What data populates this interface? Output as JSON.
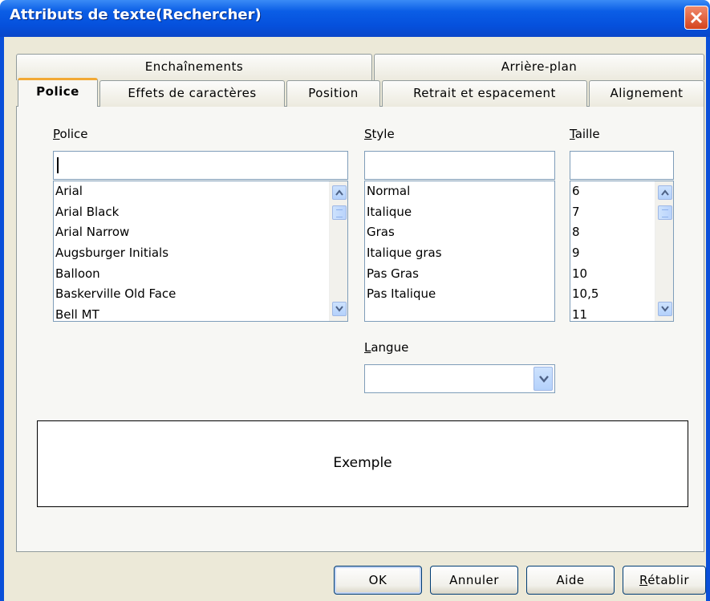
{
  "window": {
    "title": "Attributs de texte(Rechercher)",
    "close_icon": "close-icon",
    "accent_color": "#0a4fd9"
  },
  "tabs": {
    "row1": [
      {
        "label": "Enchaînements"
      },
      {
        "label": "Arrière-plan"
      }
    ],
    "row2": [
      {
        "label": "Police",
        "active": true
      },
      {
        "label": "Effets de caractères"
      },
      {
        "label": "Position"
      },
      {
        "label": "Retrait et espacement"
      },
      {
        "label": "Alignement"
      }
    ]
  },
  "font": {
    "label_mnemonic": "P",
    "label_rest": "olice",
    "value": "",
    "items": [
      "Arial",
      "Arial Black",
      "Arial Narrow",
      "Augsburger Initials",
      "Balloon",
      "Baskerville Old Face",
      "Bell MT"
    ]
  },
  "style": {
    "label_mnemonic": "S",
    "label_rest": "tyle",
    "value": "",
    "items": [
      "Normal",
      "Italique",
      "Gras",
      "Italique gras",
      "Pas Gras",
      "Pas Italique"
    ]
  },
  "size": {
    "label_mnemonic": "T",
    "label_rest": "aille",
    "value": "",
    "items": [
      "6",
      "7",
      "8",
      "9",
      "10",
      "10,5",
      "11"
    ]
  },
  "language": {
    "label_mnemonic": "L",
    "label_rest": "angue",
    "value": ""
  },
  "preview": {
    "text": "Exemple"
  },
  "buttons": {
    "ok": "OK",
    "cancel": "Annuler",
    "help": "Aide",
    "reset_mnemonic": "R",
    "reset_rest": "établir"
  }
}
